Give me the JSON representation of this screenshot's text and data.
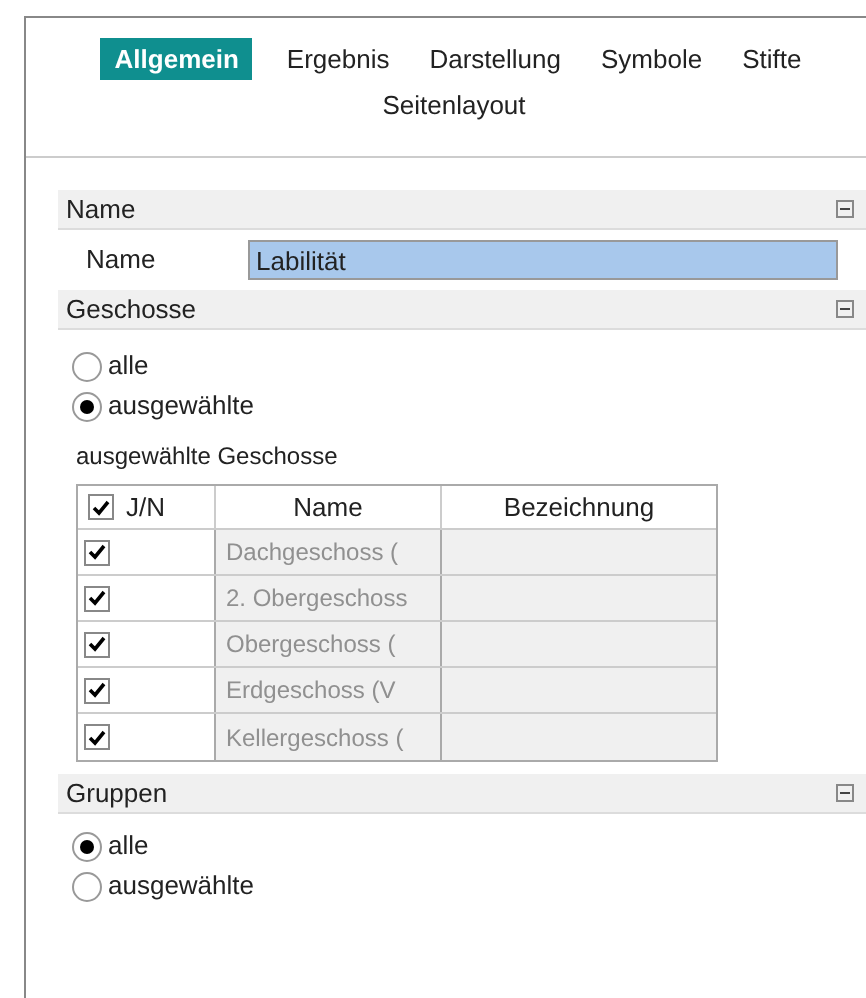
{
  "tabs": [
    {
      "label": "Allgemein",
      "selected": true
    },
    {
      "label": "Ergebnis",
      "selected": false
    },
    {
      "label": "Darstellung",
      "selected": false
    },
    {
      "label": "Symbole",
      "selected": false
    },
    {
      "label": "Stifte",
      "selected": false
    },
    {
      "label": "Seitenlayout",
      "selected": false
    }
  ],
  "name_section": {
    "title": "Name",
    "expanded": true,
    "label": "Name",
    "value": "Labilität"
  },
  "geschosse": {
    "title": "Geschosse",
    "expanded": true,
    "options": [
      {
        "label": "alle",
        "selected": false
      },
      {
        "label": "ausgewählte",
        "selected": true
      }
    ],
    "table_title": "ausgewählte Geschosse",
    "columns": [
      "J/N",
      "Name",
      "Bezeichnung"
    ],
    "header_checked": true,
    "rows": [
      {
        "checked": true,
        "name": "Dachgeschoss ("
      },
      {
        "checked": true,
        "name": "2. Obergeschoss"
      },
      {
        "checked": true,
        "name": "Obergeschoss ("
      },
      {
        "checked": true,
        "name": "Erdgeschoss (V"
      },
      {
        "checked": true,
        "name": "Kellergeschoss ("
      }
    ]
  },
  "gruppen": {
    "title": "Gruppen",
    "expanded": true,
    "options": [
      {
        "label": "alle",
        "selected": true
      },
      {
        "label": "ausgewählte",
        "selected": false
      }
    ]
  }
}
